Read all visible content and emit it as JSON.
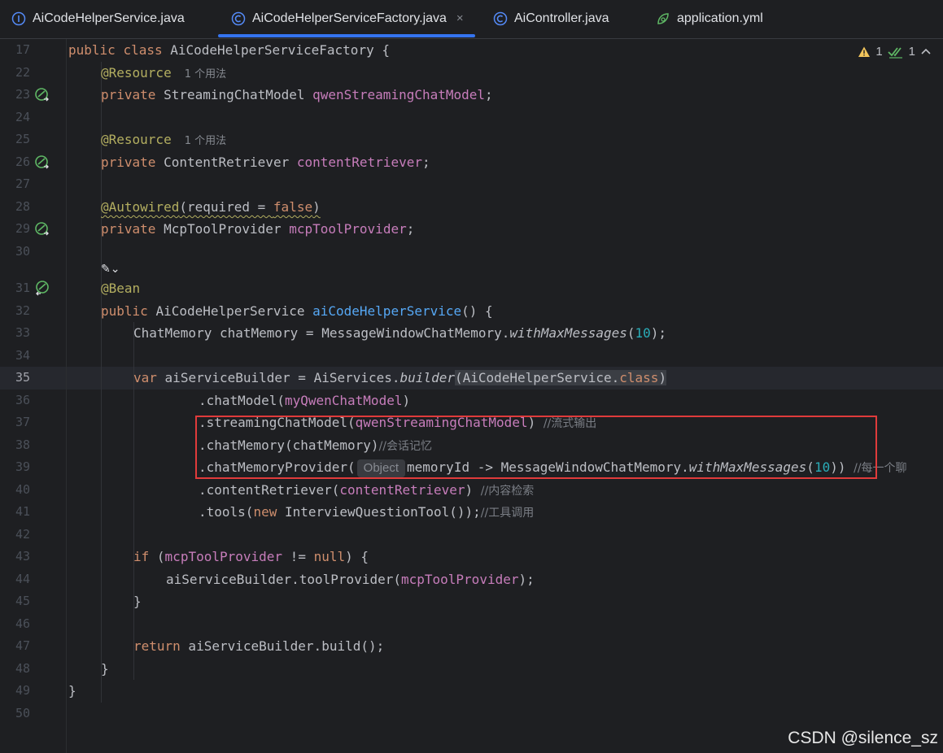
{
  "tabs": [
    {
      "label": "AiCodeHelperService.java",
      "icon": "interface-icon",
      "active": false,
      "closable": false
    },
    {
      "label": "AiCodeHelperServiceFactory.java",
      "icon": "class-icon",
      "active": true,
      "closable": true,
      "close_glyph": "×"
    },
    {
      "label": "AiController.java",
      "icon": "class-icon",
      "active": false,
      "closable": false
    },
    {
      "label": "application.yml",
      "icon": "spring-config-icon",
      "active": false,
      "closable": false
    }
  ],
  "status": {
    "warnings": "1",
    "passes": "1"
  },
  "line_numbers": [
    "17",
    "22",
    "23",
    "24",
    "25",
    "26",
    "27",
    "28",
    "29",
    "30",
    "31",
    "32",
    "33",
    "34",
    "35",
    "36",
    "37",
    "38",
    "39",
    "40",
    "41",
    "42",
    "43",
    "44",
    "45",
    "46",
    "47",
    "48",
    "49",
    "50"
  ],
  "current_line": "35",
  "code": {
    "l17_kw1": "public",
    "l17_kw2": "class",
    "l17_name": "AiCodeHelperServiceFactory {",
    "l22_ann": "@Resource",
    "l22_hint": "1 个用法",
    "l23_kw": "private",
    "l23_type": "StreamingChatModel",
    "l23_field": "qwenStreamingChatModel",
    "l23_end": ";",
    "l25_ann": "@Resource",
    "l25_hint": "1 个用法",
    "l26_kw": "private",
    "l26_type": "ContentRetriever",
    "l26_field": "contentRetriever",
    "l26_end": ";",
    "l28_ann": "@Autowired",
    "l28_args_a": "(required = ",
    "l28_false": "false",
    "l28_args_b": ")",
    "l29_kw": "private",
    "l29_type": "McpToolProvider",
    "l29_field": "mcpToolProvider",
    "l29_end": ";",
    "l30_icon_glyph": "✎⌄",
    "l31_ann": "@Bean",
    "l32_kw": "public",
    "l32_type": "AiCodeHelperService",
    "l32_fn": "aiCodeHelperService",
    "l32_end": "() {",
    "l33_a": "ChatMemory chatMemory = MessageWindowChatMemory.",
    "l33_it": "withMaxMessages",
    "l33_b": "(",
    "l33_num": "10",
    "l33_c": ");",
    "l35_kw": "var",
    "l35_a": "aiServiceBuilder = AiServices.",
    "l35_it": "builder",
    "l35_b": "(AiCodeHelperService.",
    "l35_cls": "class",
    "l35_c": ")",
    "l36_a": ".chatModel(",
    "l36_field": "myQwenChatModel",
    "l36_b": ")",
    "l37_a": ".streamingChatModel(",
    "l37_field": "qwenStreamingChatModel",
    "l37_b": ") ",
    "l37_cmt": "//流式输出",
    "l38_a": ".chatMemory(chatMemory)",
    "l38_cmt": "//会话记忆",
    "l39_a": ".chatMemoryProvider(",
    "l39_inlay": "Object",
    "l39_b": "memoryId -> MessageWindowChatMemory.",
    "l39_it": "withMaxMessages",
    "l39_c": "(",
    "l39_num": "10",
    "l39_d": ")) ",
    "l39_cmt": "//每一个聊",
    "l40_a": ".contentRetriever(",
    "l40_field": "contentRetriever",
    "l40_b": ") ",
    "l40_cmt": "//内容检索",
    "l41_a": ".tools(",
    "l41_kw": "new",
    "l41_b": " InterviewQuestionTool());",
    "l41_cmt": "//工具调用",
    "l43_kw": "if",
    "l43_a": "(",
    "l43_field": "mcpToolProvider",
    "l43_b": " != ",
    "l43_null": "null",
    "l43_c": ") {",
    "l44_a": "aiServiceBuilder.toolProvider(",
    "l44_field": "mcpToolProvider",
    "l44_b": ");",
    "l45": "}",
    "l47_kw": "return",
    "l47_a": " aiServiceBuilder.build();",
    "l48": "}",
    "l49": "}"
  },
  "gutter_icons": [
    "bean-injection-icon",
    "bean-injection-icon",
    "bean-injection-icon",
    "bean-provider-icon"
  ],
  "watermark": "CSDN @silence_sz",
  "colors": {
    "keyword": "#cf8e6d",
    "annotation": "#b3ae60",
    "field": "#c77dbb",
    "function": "#56a8f5",
    "number": "#2aacb8",
    "highlight_box": "#e03b3b",
    "active_tab": "#3574f0"
  }
}
